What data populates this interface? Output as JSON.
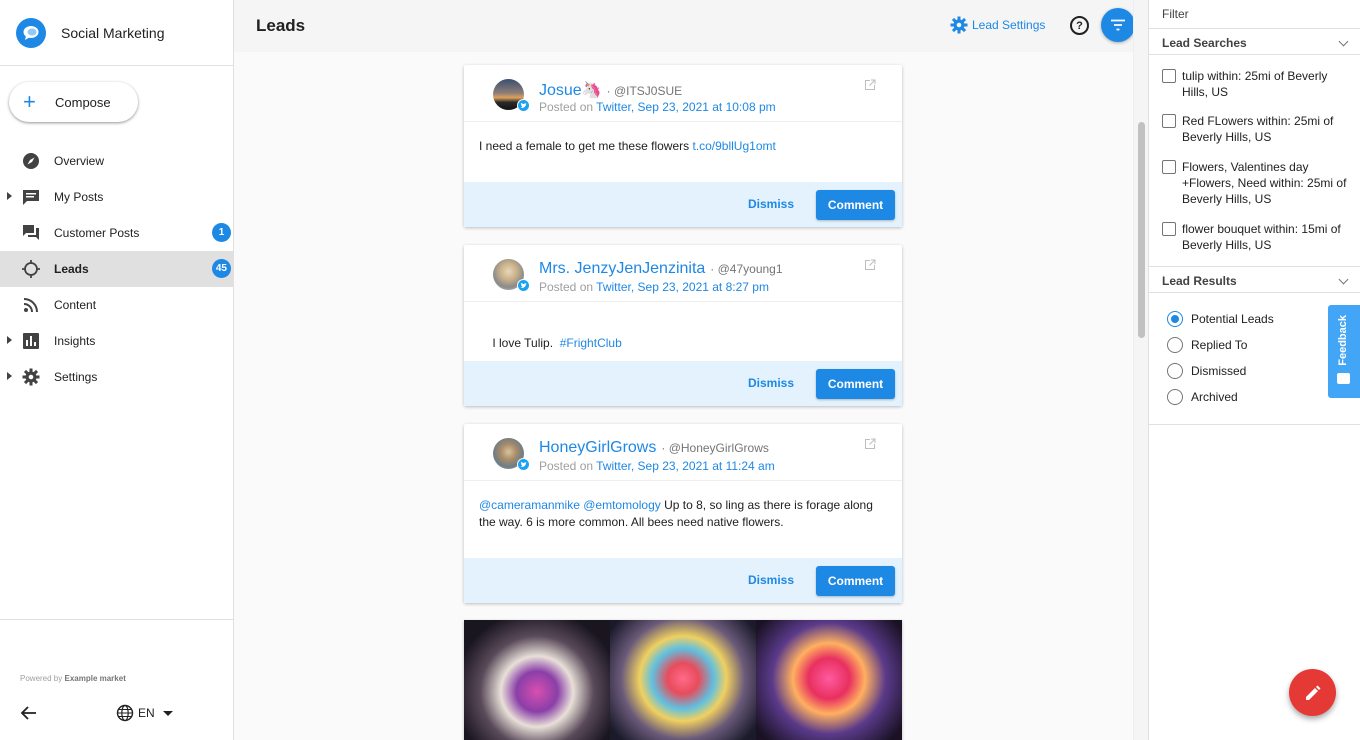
{
  "app": {
    "title": "Social Marketing",
    "brand_color": "#1e88e5"
  },
  "compose": {
    "label": "Compose"
  },
  "nav": {
    "items": [
      {
        "label": "Overview",
        "icon": "compass-icon"
      },
      {
        "label": "My Posts",
        "icon": "message-icon"
      },
      {
        "label": "Customer Posts",
        "icon": "forum-icon",
        "badge": "1"
      },
      {
        "label": "Leads",
        "icon": "crosshair-icon",
        "badge": "45",
        "active": true
      },
      {
        "label": "Content",
        "icon": "rss-icon"
      },
      {
        "label": "Insights",
        "icon": "bar-chart-icon"
      },
      {
        "label": "Settings",
        "icon": "gear-icon"
      }
    ]
  },
  "footer": {
    "powered_prefix": "Powered by",
    "powered_brand": "Example market",
    "lang": "EN"
  },
  "header": {
    "title": "Leads",
    "lead_settings": "Lead Settings",
    "help": "?"
  },
  "posts": [
    {
      "author": "Josue🦄",
      "handle": "· @ITSJ0SUE",
      "posted_prefix": "Posted on",
      "posted_link": "Twitter, Sep 23, 2021 at 10:08 pm",
      "text": "I need a female to get me these flowers ",
      "link": "t.co/9bllUg1omt",
      "dismiss": "Dismiss",
      "comment": "Comment"
    },
    {
      "author": "Mrs. JenzyJenJenzinita",
      "handle": "· @47young1",
      "posted_prefix": "Posted on",
      "posted_link": "Twitter, Sep 23, 2021 at 8:27 pm",
      "text": "I love Tulip.  ",
      "link": "#FrightClub",
      "dismiss": "Dismiss",
      "comment": "Comment"
    },
    {
      "author": "HoneyGirlGrows",
      "handle": "· @HoneyGirlGrows",
      "posted_prefix": "Posted on",
      "posted_link": "Twitter, Sep 23, 2021 at 11:24 am",
      "mention1": "@cameramanmike",
      "mention2": "@emtomology",
      "text": " Up to 8, so ling as there is forage along the way. 6 is more common. All bees need native flowers.",
      "dismiss": "Dismiss",
      "comment": "Comment"
    }
  ],
  "filter": {
    "title": "Filter",
    "lead_searches": {
      "title": "Lead Searches",
      "items": [
        "tulip within: 25mi of Beverly Hills, US",
        "Red FLowers within: 25mi of Beverly Hills, US",
        "Flowers, Valentines day +Flowers, Need within: 25mi of Beverly Hills, US",
        "flower bouquet within: 15mi of Beverly Hills, US"
      ]
    },
    "lead_results": {
      "title": "Lead Results",
      "options": [
        "Potential Leads",
        "Replied To",
        "Dismissed",
        "Archived"
      ],
      "selected": "Potential Leads"
    }
  },
  "feedback": {
    "label": "Feedback"
  }
}
